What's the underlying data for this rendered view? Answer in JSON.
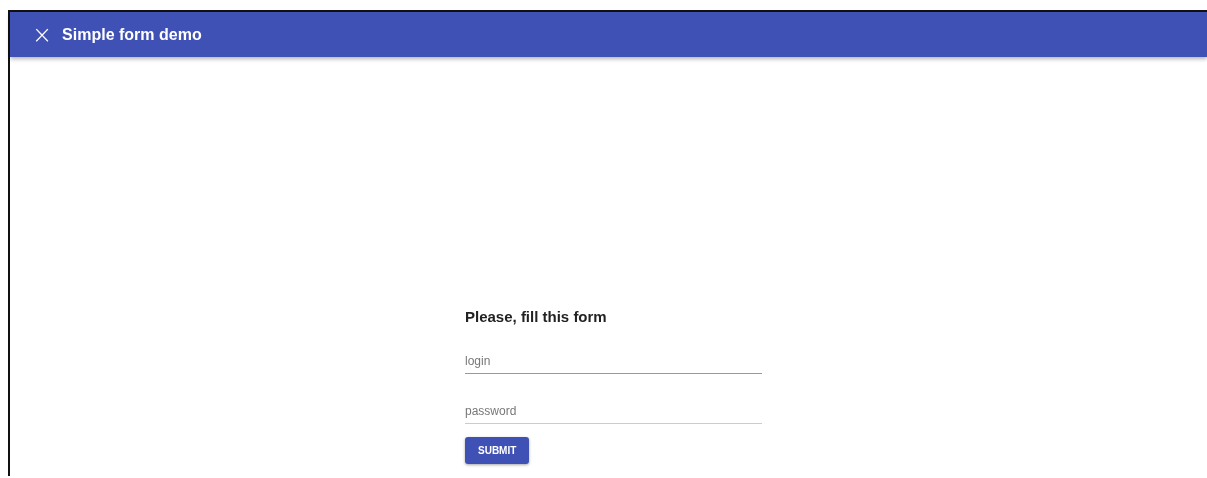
{
  "app_bar": {
    "icon": "×",
    "title": "Simple form demo"
  },
  "form": {
    "heading": "Please, fill this form",
    "fields": [
      {
        "placeholder": "login",
        "kind": "text"
      },
      {
        "placeholder": "password",
        "kind": "password"
      }
    ],
    "submit": "SUBMIT"
  }
}
